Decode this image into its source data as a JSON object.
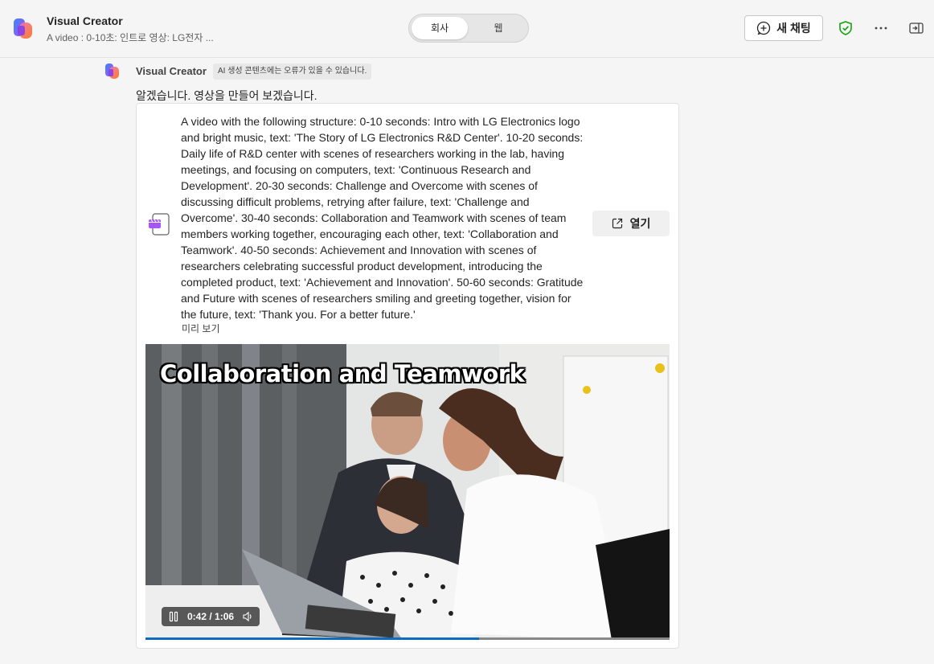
{
  "header": {
    "app_title": "Visual Creator",
    "app_subtitle": "A video : 0-10초: 인트로 영상: LG전자 ...",
    "toggle": {
      "options": [
        "회사",
        "웹"
      ],
      "selected": "회사"
    },
    "new_chat_label": "새 채팅",
    "icons": [
      "shield-check-icon",
      "more-icon",
      "sidebar-toggle-icon"
    ]
  },
  "message": {
    "sender": "Visual Creator",
    "ai_notice": "AI 생성 콘텐츠에는 오류가 있을 수 있습니다.",
    "reply": "알겠습니다. 영상을 만들어 보겠습니다.",
    "card": {
      "prompt": "A video with the following structure: 0-10 seconds: Intro with LG Electronics logo and bright music, text: 'The Story of LG Electronics R&D Center'. 10-20 seconds: Daily life of R&D center with scenes of researchers working in the lab, having meetings, and focusing on computers, text: 'Continuous Research and Development'. 20-30 seconds: Challenge and Overcome with scenes of discussing difficult problems, retrying after failure, text: 'Challenge and Overcome'. 30-40 seconds: Collaboration and Teamwork with scenes of team members working together, encouraging each other, text: 'Collaboration and Teamwork'. 40-50 seconds: Achievement and Innovation with scenes of researchers celebrating successful product development, introducing the completed product, text: 'Achievement and Innovation'. 50-60 seconds: Gratitude and Future with scenes of researchers smiling and greeting together, vision for the future, text: 'Thank you. For a better future.'",
      "preview_label": "미리 보기",
      "open_label": "열기",
      "video": {
        "caption": "Collaboration and Teamwork",
        "time": "0:42 / 1:06",
        "progress": 0.636
      }
    }
  },
  "colors": {
    "accent": "#0f6cbd",
    "shield": "#13a10e",
    "background": "#f5f5f5"
  }
}
